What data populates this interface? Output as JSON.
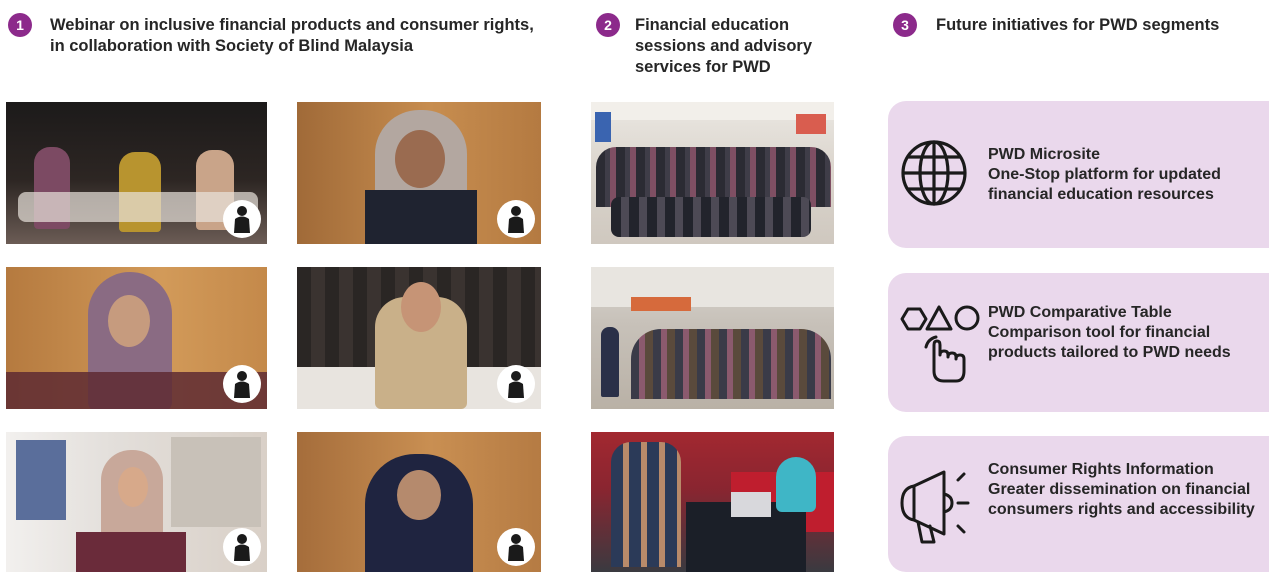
{
  "sections": [
    {
      "number": "1",
      "heading": "Webinar on inclusive financial products and consumer rights, in collaboration with Society of Blind Malaysia"
    },
    {
      "number": "2",
      "heading": "Financial education sessions and advisory services for PWD"
    },
    {
      "number": "3",
      "heading": "Future initiatives for PWD segments"
    }
  ],
  "initiatives": [
    {
      "title": "PWD Microsite",
      "description": "One-Stop platform for updated financial education resources",
      "icon": "globe-icon"
    },
    {
      "title": "PWD Comparative Table",
      "description": "Comparison tool for financial products tailored to PWD needs",
      "icon": "shapes-hand-icon"
    },
    {
      "title": "Consumer Rights Information",
      "description": "Greater dissemination on financial consumers rights and accessibility",
      "icon": "megaphone-icon"
    }
  ],
  "colors": {
    "badge": "#8c2a8b",
    "card": "#ead8ec",
    "text": "#262626"
  }
}
